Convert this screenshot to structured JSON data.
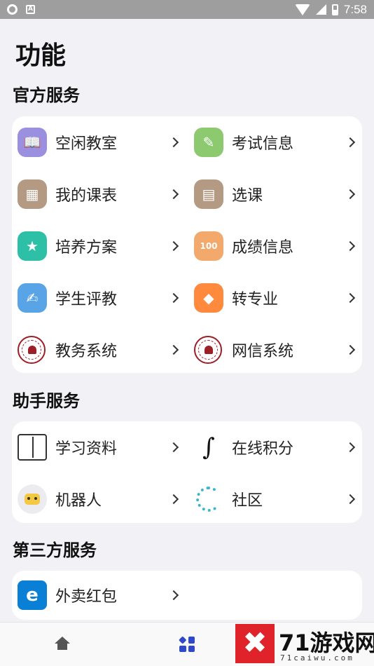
{
  "status_bar": {
    "time": "7:58"
  },
  "page_title": "功能",
  "sections": [
    {
      "title": "官方服务",
      "items": [
        {
          "label": "空闲教室",
          "icon": "book-open-icon",
          "color": "#9b8fe0",
          "glyph": "📖"
        },
        {
          "label": "考试信息",
          "icon": "exam-pencil-icon",
          "color": "#8cc96f",
          "glyph": "✎"
        },
        {
          "label": "我的课表",
          "icon": "calendar-icon",
          "color": "#b49a82",
          "glyph": "▦"
        },
        {
          "label": "选课",
          "icon": "course-select-icon",
          "color": "#b49a82",
          "glyph": "▤"
        },
        {
          "label": "培养方案",
          "icon": "plan-book-icon",
          "color": "#2dc0a6",
          "glyph": "★"
        },
        {
          "label": "成绩信息",
          "icon": "score-icon",
          "color": "#f2a96b",
          "glyph": "100"
        },
        {
          "label": "学生评教",
          "icon": "evaluate-icon",
          "color": "#58a4e6",
          "glyph": "✍"
        },
        {
          "label": "转专业",
          "icon": "transfer-icon",
          "color": "#ff8a3d",
          "glyph": "◆"
        },
        {
          "label": "教务系统",
          "icon": "university-seal-icon",
          "color": "#9c1f27",
          "glyph": ""
        },
        {
          "label": "网信系统",
          "icon": "university-seal-icon",
          "color": "#9c1f27",
          "glyph": ""
        }
      ]
    },
    {
      "title": "助手服务",
      "items": [
        {
          "label": "学习资料",
          "icon": "open-book-icon",
          "color": "#ffffff",
          "glyph": ""
        },
        {
          "label": "在线积分",
          "icon": "integral-icon",
          "color": "#ffffff",
          "glyph": "∫"
        },
        {
          "label": "机器人",
          "icon": "robot-icon",
          "color": "#ececf0",
          "glyph": ""
        },
        {
          "label": "社区",
          "icon": "community-ring-icon",
          "color": "#39b6c9",
          "glyph": ""
        }
      ]
    },
    {
      "title": "第三方服务",
      "items": [
        {
          "label": "外卖红包",
          "icon": "eleme-icon",
          "color": "#0a7fd6",
          "glyph": "e"
        }
      ]
    }
  ],
  "tabbar": {
    "items": [
      {
        "name": "home",
        "icon": "home-icon"
      },
      {
        "name": "functions",
        "icon": "grid-icon",
        "active": true
      }
    ]
  },
  "watermark": {
    "logo": "✖",
    "title": "71游戏网",
    "sub": "71caiwu.com"
  }
}
